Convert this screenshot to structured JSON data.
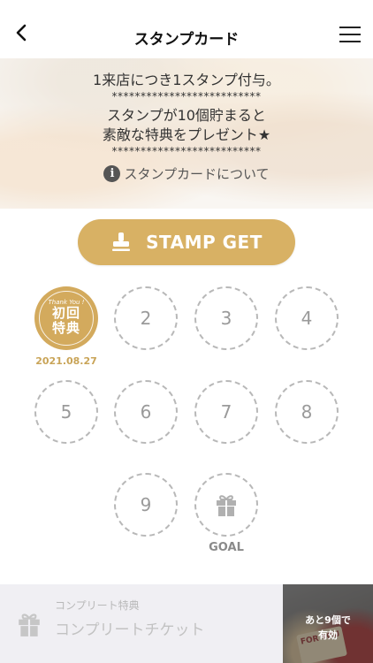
{
  "header": {
    "title": "スタンプカード"
  },
  "banner": {
    "line1": "1来店につき1スタンプ付与。",
    "stars1": "**************************",
    "line2": "スタンプが10個貯まると",
    "line3": "素敵な特典をプレゼント★",
    "stars2": "**************************",
    "about_label": "スタンプカードについて",
    "about_icon": "info-icon"
  },
  "stamp_button": {
    "label": "STAMP GET",
    "icon": "stamp-icon",
    "color": "#d8b164"
  },
  "stamps": {
    "first": {
      "thank": "Thank You !",
      "text1": "初回",
      "text2": "特典",
      "date": "2021.08.27",
      "color": "#d3aa5d"
    },
    "slots": [
      "2",
      "3",
      "4",
      "5",
      "6",
      "7",
      "8",
      "9"
    ],
    "goal_label": "GOAL",
    "goal_icon": "gift-icon"
  },
  "bottom": {
    "subtitle": "コンプリート特典",
    "title": "コンプリートチケット",
    "icon": "gift-icon",
    "ticket": {
      "line1": "あと9個で",
      "line2": "有効",
      "deco": "FOR YOU"
    }
  }
}
